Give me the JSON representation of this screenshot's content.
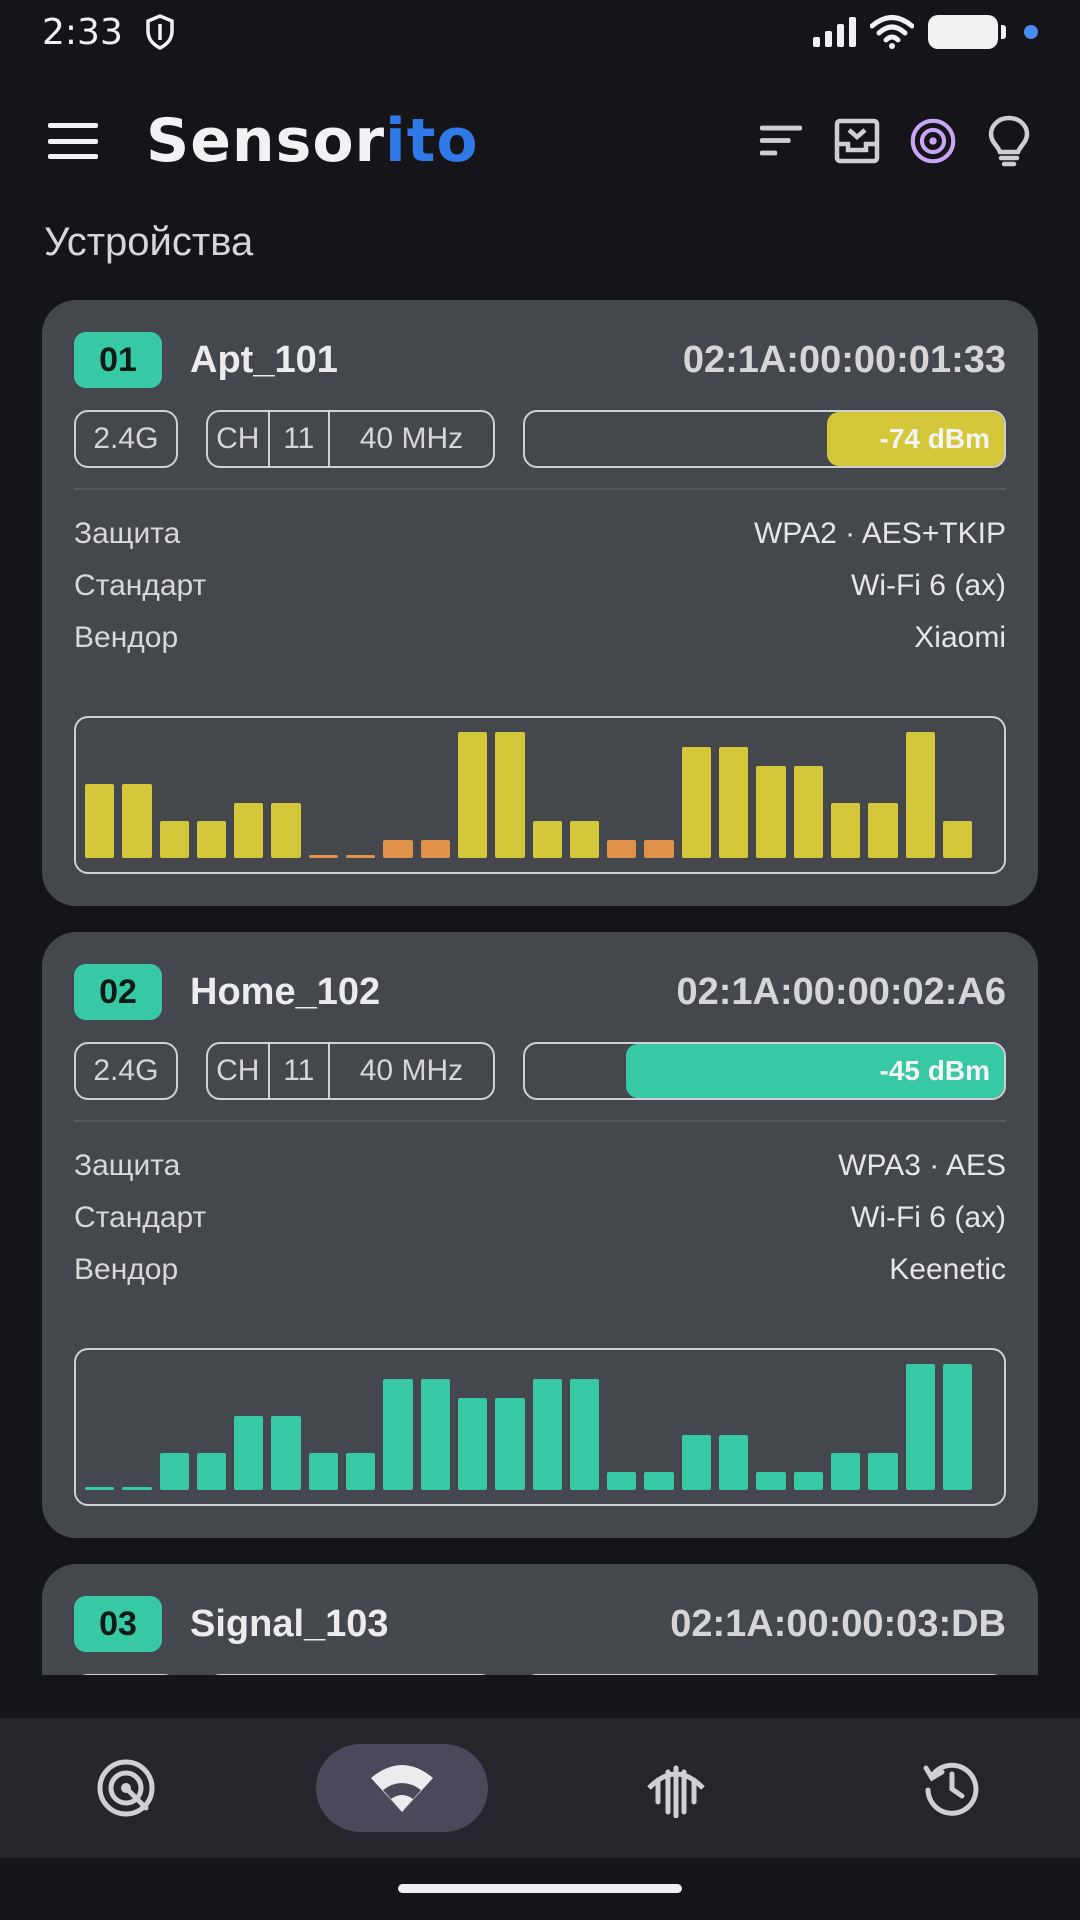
{
  "status": {
    "time": "2:33"
  },
  "app": {
    "logo_a": "Sensor",
    "logo_b": "ito"
  },
  "section_title": "Устройства",
  "labels": {
    "security": "Защита",
    "standard": "Стандарт",
    "vendor": "Вендор",
    "ch": "CH"
  },
  "colors": {
    "accent": "#37c9a3",
    "weak": "#d4c83a",
    "very_weak": "#e0914a",
    "brand": "#2f7ae8"
  },
  "devices": [
    {
      "index": "01",
      "ssid": "Apt_101",
      "mac": "02:1A:00:00:01:33",
      "band": "2.4G",
      "channel": "11",
      "width": "40 MHz",
      "rssi": "-74 dBm",
      "signal_fraction": 0.37,
      "signal_color": "#d4c83a",
      "security": "WPA2 · AES+TKIP",
      "standard": "Wi-Fi 6 (ax)",
      "vendor": "Xiaomi",
      "history": [
        0.59,
        0.59,
        0.29,
        0.29,
        0.44,
        0.44,
        0.02,
        0.02,
        0.14,
        0.14,
        1.0,
        1.0,
        0.29,
        0.29,
        0.14,
        0.14,
        0.88,
        0.88,
        0.73,
        0.73,
        0.44,
        0.44,
        1.0,
        0.29
      ],
      "history_colors": [
        "w",
        "w",
        "w",
        "w",
        "w",
        "w",
        "o",
        "o",
        "o",
        "o",
        "w",
        "w",
        "w",
        "w",
        "o",
        "o",
        "w",
        "w",
        "w",
        "w",
        "w",
        "w",
        "w",
        "w"
      ]
    },
    {
      "index": "02",
      "ssid": "Home_102",
      "mac": "02:1A:00:00:02:A6",
      "band": "2.4G",
      "channel": "11",
      "width": "40 MHz",
      "rssi": "-45 dBm",
      "signal_fraction": 0.79,
      "signal_color": "#37c9a3",
      "security": "WPA3 · AES",
      "standard": "Wi-Fi 6 (ax)",
      "vendor": "Keenetic",
      "history": [
        0.02,
        0.02,
        0.29,
        0.29,
        0.59,
        0.59,
        0.29,
        0.29,
        0.88,
        0.88,
        0.73,
        0.73,
        0.88,
        0.88,
        0.14,
        0.14,
        0.44,
        0.44,
        0.14,
        0.14,
        0.29,
        0.29,
        1.0,
        1.0
      ],
      "history_colors": [
        "g",
        "g",
        "g",
        "g",
        "g",
        "g",
        "g",
        "g",
        "g",
        "g",
        "g",
        "g",
        "g",
        "g",
        "g",
        "g",
        "g",
        "g",
        "g",
        "g",
        "g",
        "g",
        "g",
        "g"
      ]
    },
    {
      "index": "03",
      "ssid": "Signal_103",
      "mac": "02:1A:00:00:03:DB"
    }
  ],
  "nav": [
    {
      "icon": "radar-icon"
    },
    {
      "icon": "wifi-icon",
      "active": true
    },
    {
      "icon": "signal-spectrum-icon"
    },
    {
      "icon": "history-icon"
    }
  ]
}
